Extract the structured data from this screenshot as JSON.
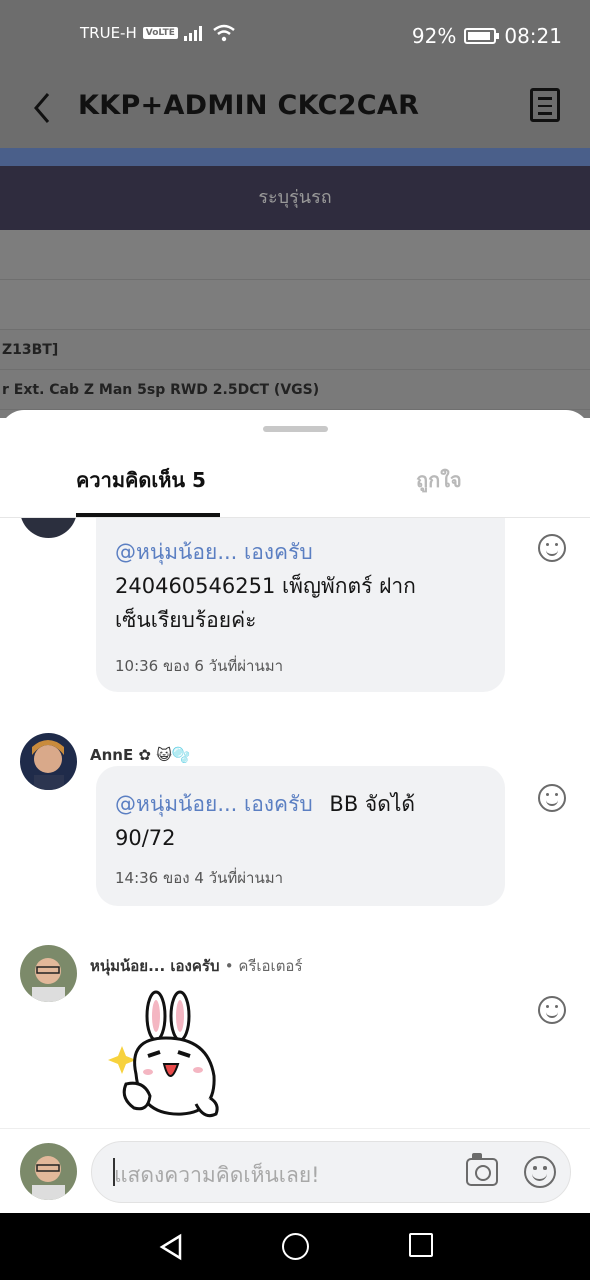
{
  "status_bar": {
    "carrier": "TRUE-H",
    "volte": "VoLTE",
    "battery": "92%",
    "time": "08:21"
  },
  "header": {
    "title": "KKP+ADMIN CKC2CAR"
  },
  "web_content": {
    "banner": "ระบุรุ่นรถ",
    "row1": "Z13BT]",
    "row2": "r Ext. Cab Z Man 5sp RWD 2.5DCT (VGS)"
  },
  "tabs": {
    "comments": "ความคิดเห็น 5",
    "likes": "ถูกใจ"
  },
  "comments": [
    {
      "mention": "@หนุ่มน้อย... เองครับ",
      "text_line1": "240460546251 เพ็ญพักตร์ ฝาก",
      "text_line2": "เซ็นเรียบร้อยค่ะ",
      "meta": "10:36 ของ 6 วันที่ผ่านมา"
    },
    {
      "username": "AnnE ✿ 😺🫧",
      "mention": "@หนุ่มน้อย... เองครับ",
      "text_inline": "BB จัดได้",
      "text_line2": "90/72",
      "meta": "14:36 ของ 4 วันที่ผ่านมา"
    },
    {
      "username": "หนุ่มน้อย... เองครับ",
      "role": "• ครีเอเตอร์"
    }
  ],
  "input": {
    "placeholder": "แสดงความคิดเห็นเลย!"
  },
  "colors": {
    "mention": "#5b7fc2",
    "bubble": "#f1f2f4",
    "dim_overlay": "#6d6d6d"
  }
}
